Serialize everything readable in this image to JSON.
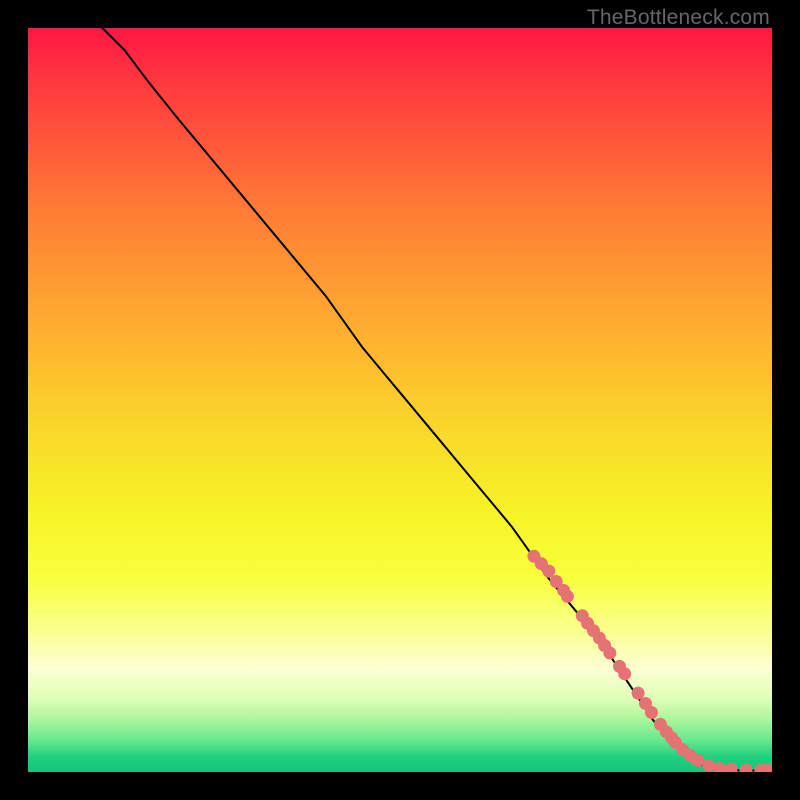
{
  "watermark": "TheBottleneck.com",
  "chart_data": {
    "type": "line",
    "title": "",
    "xlabel": "",
    "ylabel": "",
    "xlim": [
      0,
      100
    ],
    "ylim": [
      0,
      100
    ],
    "grid": false,
    "legend": false,
    "series": [
      {
        "name": "curve",
        "type": "line",
        "x": [
          10,
          13,
          16,
          20,
          25,
          30,
          35,
          40,
          45,
          50,
          55,
          60,
          65,
          70,
          75,
          78,
          80,
          82,
          84,
          86,
          88,
          90,
          92,
          94,
          96,
          98,
          100
        ],
        "y": [
          100,
          97,
          93,
          88,
          82,
          76,
          70,
          64,
          57,
          51,
          45,
          39,
          33,
          26,
          20,
          16,
          13,
          10,
          7,
          4.5,
          2.5,
          1.2,
          0.5,
          0.3,
          0.2,
          0.2,
          0.2
        ]
      },
      {
        "name": "markers",
        "type": "scatter",
        "x": [
          68,
          69,
          70,
          71,
          72,
          72.5,
          74.5,
          75.2,
          76,
          76.8,
          77.5,
          78.2,
          79.5,
          80.2,
          82,
          83,
          83.8,
          85,
          85.8,
          86.5,
          87,
          88,
          89,
          90,
          91.5,
          93,
          94.5,
          96.5,
          98.5,
          99.5
        ],
        "y": [
          29,
          28,
          27,
          25.6,
          24.4,
          23.6,
          21,
          20,
          19,
          18,
          17,
          16,
          14.2,
          13.2,
          10.6,
          9.2,
          8,
          6.4,
          5.4,
          4.6,
          4,
          3,
          2.2,
          1.6,
          0.9,
          0.5,
          0.4,
          0.3,
          0.3,
          0.3
        ]
      }
    ],
    "colors": {
      "line": "#000000",
      "marker_fill": "#e57373",
      "marker_stroke": "#b94a4a"
    }
  }
}
